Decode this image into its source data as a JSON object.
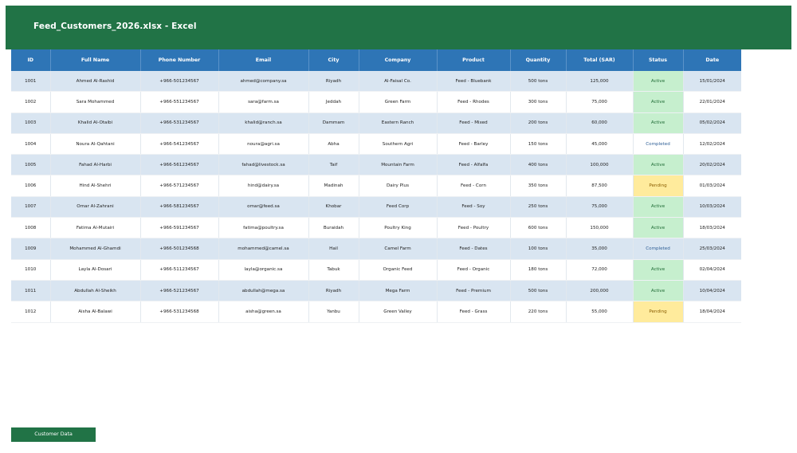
{
  "window": {
    "title": "Feed_Customers_2026.xlsx - Excel"
  },
  "colors": {
    "titlebar": "#217346",
    "header": "#2e75b6",
    "row_shade": "#d9e5f1",
    "status_active": "#c6efce",
    "status_pending": "#ffeb9c",
    "sheet_tab": "#217346"
  },
  "table": {
    "columns": [
      "ID",
      "Full Name",
      "Phone Number",
      "Email",
      "City",
      "Company",
      "Product",
      "Quantity",
      "Total (SAR)",
      "Status",
      "Date"
    ],
    "rows": [
      [
        "1001",
        "Ahmed Al-Rashid",
        "+966-501234567",
        "ahmed@company.sa",
        "Riyadh",
        "Al-Faisal Co.",
        "Feed - Bluebank",
        "500 tons",
        "125,000",
        "Active",
        "15/01/2024"
      ],
      [
        "1002",
        "Sara Mohammed",
        "+966-551234567",
        "sara@farm.sa",
        "Jeddah",
        "Green Farm",
        "Feed - Rhodes",
        "300 tons",
        "75,000",
        "Active",
        "22/01/2024"
      ],
      [
        "1003",
        "Khalid Al-Otaibi",
        "+966-531234567",
        "khalid@ranch.sa",
        "Dammam",
        "Eastern Ranch",
        "Feed - Mixed",
        "200 tons",
        "60,000",
        "Active",
        "05/02/2024"
      ],
      [
        "1004",
        "Noura Al-Qahtani",
        "+966-541234567",
        "noura@agri.sa",
        "Abha",
        "Southern Agri",
        "Feed - Barley",
        "150 tons",
        "45,000",
        "Completed",
        "12/02/2024"
      ],
      [
        "1005",
        "Fahad Al-Harbi",
        "+966-561234567",
        "fahad@livestock.sa",
        "Taif",
        "Mountain Farm",
        "Feed - Alfalfa",
        "400 tons",
        "100,000",
        "Active",
        "20/02/2024"
      ],
      [
        "1006",
        "Hind Al-Shehri",
        "+966-571234567",
        "hind@dairy.sa",
        "Madinah",
        "Dairy Plus",
        "Feed - Corn",
        "350 tons",
        "87,500",
        "Pending",
        "01/03/2024"
      ],
      [
        "1007",
        "Omar Al-Zahrani",
        "+966-581234567",
        "omar@feed.sa",
        "Khobar",
        "Feed Corp",
        "Feed - Soy",
        "250 tons",
        "75,000",
        "Active",
        "10/03/2024"
      ],
      [
        "1008",
        "Fatima Al-Mutairi",
        "+966-591234567",
        "fatima@poultry.sa",
        "Buraidah",
        "Poultry King",
        "Feed - Poultry",
        "600 tons",
        "150,000",
        "Active",
        "18/03/2024"
      ],
      [
        "1009",
        "Mohammed Al-Ghamdi",
        "+966-501234568",
        "mohammed@camel.sa",
        "Hail",
        "Camel Farm",
        "Feed - Dates",
        "100 tons",
        "35,000",
        "Completed",
        "25/03/2024"
      ],
      [
        "1010",
        "Layla Al-Dosari",
        "+966-511234567",
        "layla@organic.sa",
        "Tabuk",
        "Organic Feed",
        "Feed - Organic",
        "180 tons",
        "72,000",
        "Active",
        "02/04/2024"
      ],
      [
        "1011",
        "Abdullah Al-Sheikh",
        "+966-521234567",
        "abdullah@mega.sa",
        "Riyadh",
        "Mega Farm",
        "Feed - Premium",
        "500 tons",
        "200,000",
        "Active",
        "10/04/2024"
      ],
      [
        "1012",
        "Aisha Al-Balawi",
        "+966-531234568",
        "aisha@green.sa",
        "Yanbu",
        "Green Valley",
        "Feed - Grass",
        "220 tons",
        "55,000",
        "Pending",
        "18/04/2024"
      ]
    ]
  },
  "sheet_tabs": [
    "Customer Data"
  ]
}
